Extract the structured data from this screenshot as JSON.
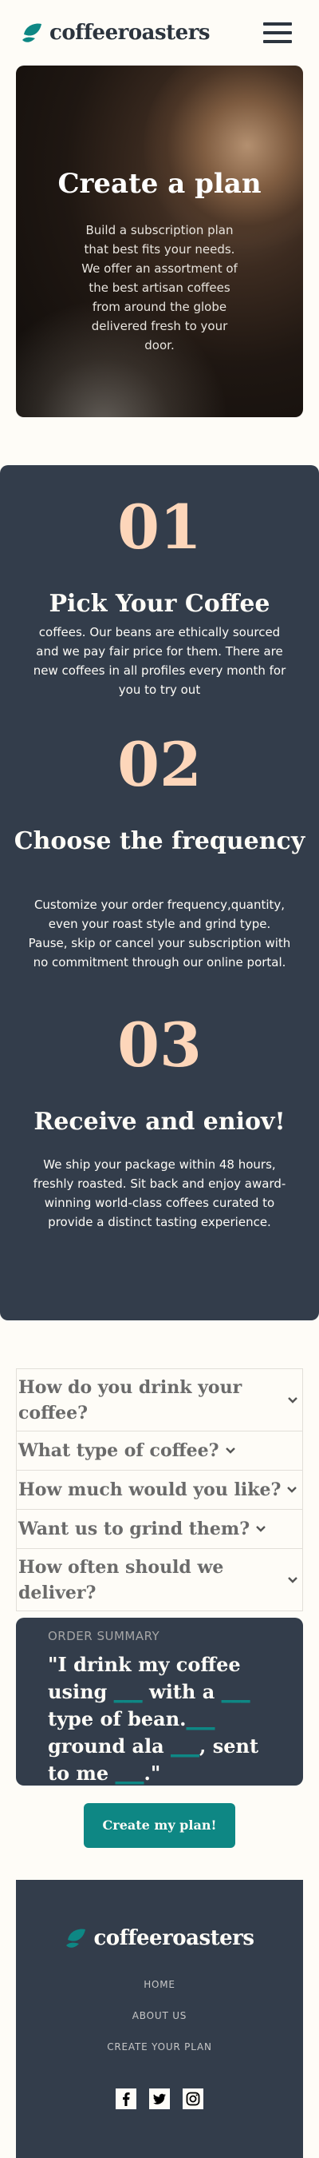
{
  "header": {
    "brand": "coffeeroasters",
    "menu_icon": "hamburger-menu-icon"
  },
  "hero": {
    "title": "Create a plan",
    "text": "Build a subscription plan that best fits your needs. We offer an assortment of the best artisan coffees from around the globe delivered fresh to your door."
  },
  "steps": [
    {
      "number": "01",
      "title": "Pick Your Coffee",
      "text": "coffees. Our beans are ethically sourced and we pay fair price for them. There are new coffees in all profiles every month for you to try out"
    },
    {
      "number": "02",
      "title": "Choose the frequency",
      "text": "Customize your order frequency,quantity, even your roast style and grind type. Pause, skip or cancel your subscription with no commitment through our online portal."
    },
    {
      "number": "03",
      "title": "Receive and eniov!",
      "text": "We ship your package within 48 hours, freshly roasted. Sit back and enjoy award-winning world-class coffees curated to provide a distinct tasting experience."
    }
  ],
  "questions": [
    {
      "label": "How do you drink your coffee?"
    },
    {
      "label": "What type of coffee?"
    },
    {
      "label": "How much would you like?"
    },
    {
      "label": "Want us to grind them?"
    },
    {
      "label": "How often should we deliver?"
    }
  ],
  "summary": {
    "heading": "ORDER SUMMARY",
    "p1": "\"I drink my coffee using ",
    "b1": "___",
    "p2": " with a ",
    "b2": "___",
    "p3": " type of bean.",
    "b3": "___",
    "p4": " ground ala ",
    "b4": "___",
    "p5": ", sent to me ",
    "b5": "___",
    "p6": ".\""
  },
  "cta": {
    "label": "Create my plan!"
  },
  "footer": {
    "brand": "coffeeroasters",
    "nav": [
      "HOME",
      "ABOUT US",
      "CREATE YOUR PLAN"
    ],
    "social": [
      "facebook-icon",
      "twitter-icon",
      "instagram-icon"
    ]
  },
  "colors": {
    "accent": "#0e8784",
    "dark": "#333d4b",
    "number": "#fdd6ba",
    "background": "#fefcf7"
  }
}
